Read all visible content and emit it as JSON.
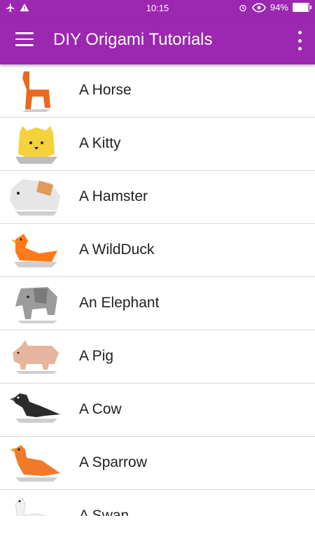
{
  "status": {
    "time": "10:15",
    "battery": "94%",
    "battery_level": 0.94
  },
  "app": {
    "title": "DIY Origami Tutorials"
  },
  "list": {
    "items": [
      {
        "label": "A Horse",
        "icon": "horse-icon",
        "color": "#e8691f"
      },
      {
        "label": "A Kitty",
        "icon": "kitty-icon",
        "color": "#f3d23b"
      },
      {
        "label": "A Hamster",
        "icon": "hamster-icon",
        "color": "#e6e6e6"
      },
      {
        "label": "A WildDuck",
        "icon": "wild-duck-icon",
        "color": "#ff7a1a"
      },
      {
        "label": "An Elephant",
        "icon": "elephant-icon",
        "color": "#9c9c9c"
      },
      {
        "label": "A Pig",
        "icon": "pig-icon",
        "color": "#e7b49d"
      },
      {
        "label": "A Cow",
        "icon": "cow-icon",
        "color": "#2b2b2b"
      },
      {
        "label": "A Sparrow",
        "icon": "sparrow-icon",
        "color": "#f07a2a"
      },
      {
        "label": "A Swan",
        "icon": "swan-icon",
        "color": "#f2f2f2"
      }
    ]
  },
  "colors": {
    "primary": "#9c27b0",
    "divider": "#d9d9d9",
    "text": "#212121"
  }
}
